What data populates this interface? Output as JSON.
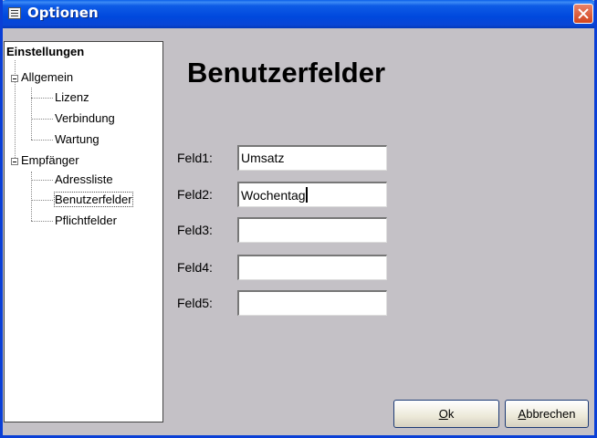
{
  "window": {
    "title": "Optionen"
  },
  "tree": {
    "root": "Einstellungen",
    "groups": [
      {
        "label": "Allgemein",
        "children": [
          "Lizenz",
          "Verbindung",
          "Wartung"
        ]
      },
      {
        "label": "Empfänger",
        "children": [
          "Adressliste",
          "Benutzerfelder",
          "Pflichtfelder"
        ]
      }
    ],
    "selected": "Benutzerfelder"
  },
  "page": {
    "title": "Benutzerfelder"
  },
  "fields": [
    {
      "label": "Feld1:",
      "value": "Umsatz"
    },
    {
      "label": "Feld2:",
      "value": "Wochentag"
    },
    {
      "label": "Feld3:",
      "value": ""
    },
    {
      "label": "Feld4:",
      "value": ""
    },
    {
      "label": "Feld5:",
      "value": ""
    }
  ],
  "buttons": {
    "ok_underlined": "O",
    "ok_rest": "k",
    "cancel_underlined": "A",
    "cancel_rest": "bbrechen"
  }
}
